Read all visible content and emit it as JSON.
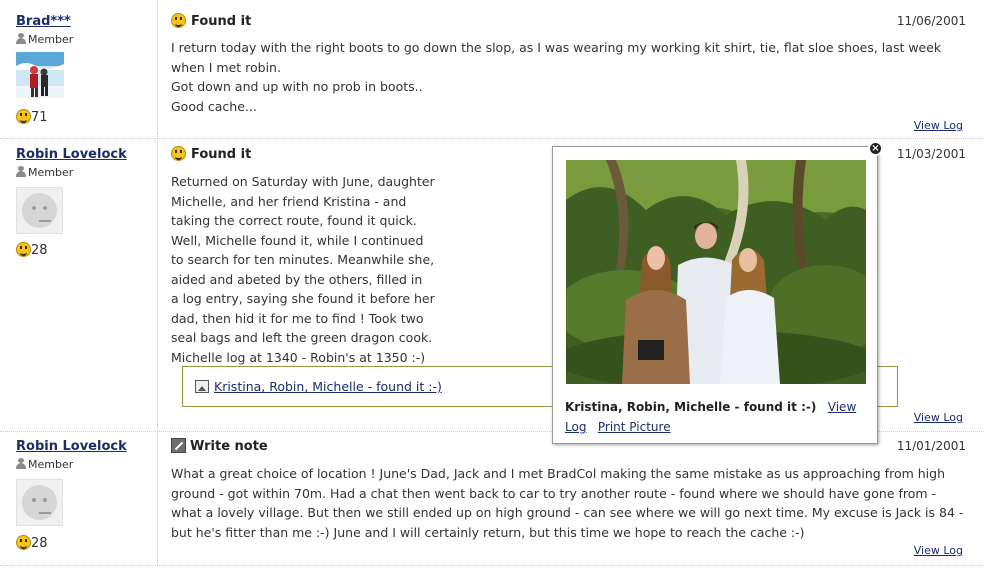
{
  "logs": [
    {
      "owner": "Brad***",
      "member_label": "Member",
      "find_count": "71",
      "type": "Found it",
      "date": "11/06/2001",
      "lines": [
        "I return today with the right boots to go down the slop, as I was wearing my working kit shirt, tie, flat sloe shoes, last week",
        "when I met robin.",
        "Got down and up with no prob in boots..",
        "Good cache..."
      ],
      "view_log": "View Log"
    },
    {
      "owner": "Robin Lovelock",
      "member_label": "Member",
      "find_count": "28",
      "type": "Found it",
      "date": "11/03/2001",
      "lines": [
        "Returned on Saturday with June, daughter",
        "Michelle, and her friend Kristina - and",
        "taking the correct route, found it quick.",
        "Well, Michelle found it, while I continued",
        "to search for ten minutes. Meanwhile she,",
        "aided and abeted by the others, filled in",
        "a log entry, saying she found it before her",
        "dad, then hid it for me to find ! Took two",
        "seal bags and left the green dragon cook.",
        "Michelle log at 1340 - Robin's at 1350 :-)"
      ],
      "image_link": "Kristina, Robin, Michelle - found it :-)",
      "view_log": "View Log"
    },
    {
      "owner": "Robin Lovelock",
      "member_label": "Member",
      "find_count": "28",
      "type": "Write note",
      "date": "11/01/2001",
      "lines": [
        "What a great choice of location ! June's Dad, Jack and I met BradCol making the same mistake as us approaching from high",
        "ground - got within 70m. Had a chat then went back to car to try another route - found where we should have gone from -",
        "what a lovely village. But then we still ended up on high ground - can see where we will go next time. My excuse is Jack is 84 -",
        "but he's fitter than me :-) June and I will certainly return, but this time we hope to reach the cache :-)"
      ],
      "view_log": "View Log"
    }
  ],
  "popup": {
    "caption_title": "Kristina, Robin, Michelle - found it :-)",
    "view_log_link": "View Log",
    "print_link": "Print Picture",
    "close_symbol": "×"
  },
  "colors": {
    "link": "#1a2d6b",
    "attachment_border": "#8aa040",
    "smiley": "#f5c518"
  },
  "icons": {
    "found": "smiley-icon",
    "note": "pencil-note-icon",
    "member": "person-icon",
    "image": "image-icon",
    "close": "close-icon"
  }
}
